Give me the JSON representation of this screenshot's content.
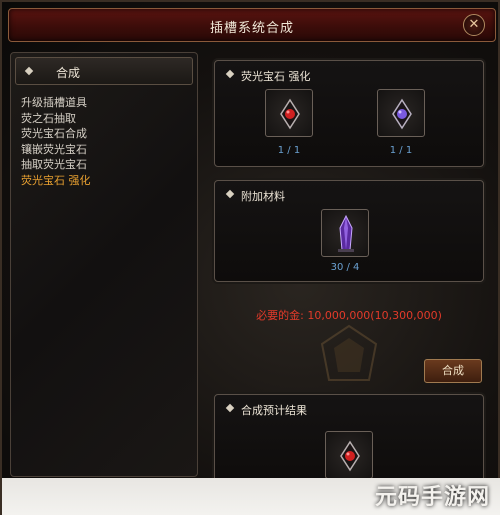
{
  "window": {
    "title": "插槽系统合成",
    "close_glyph": "✕"
  },
  "left_panel": {
    "header": "合成",
    "items": [
      {
        "label": "升级插槽道具",
        "active": false
      },
      {
        "label": "荧之石抽取",
        "active": false
      },
      {
        "label": "荧光宝石合成",
        "active": false
      },
      {
        "label": "镶嵌荧光宝石",
        "active": false
      },
      {
        "label": "抽取荧光宝石",
        "active": false
      },
      {
        "label": "荧光宝石 强化",
        "active": true
      }
    ]
  },
  "gem_panel": {
    "title": "荧光宝石 强化",
    "slots": [
      {
        "icon": "red-gem-icon",
        "count": "1 / 1"
      },
      {
        "icon": "purple-gem-icon",
        "count": "1 / 1"
      }
    ]
  },
  "material_panel": {
    "title": "附加材料",
    "slot": {
      "icon": "purple-crystal-icon",
      "count": "30 / 4"
    }
  },
  "cost": {
    "label": "必要的金:",
    "value": "10,000,000(10,300,000)"
  },
  "combine_button": "合成",
  "result_panel": {
    "title": "合成预计结果",
    "slot": {
      "icon": "red-gem-icon"
    }
  },
  "watermark": "元码手游网",
  "colors": {
    "active_menu": "#e8a030",
    "cost_text": "#e23a2a",
    "count_text": "#6aa0d0",
    "title_bar": "#5a1410"
  }
}
